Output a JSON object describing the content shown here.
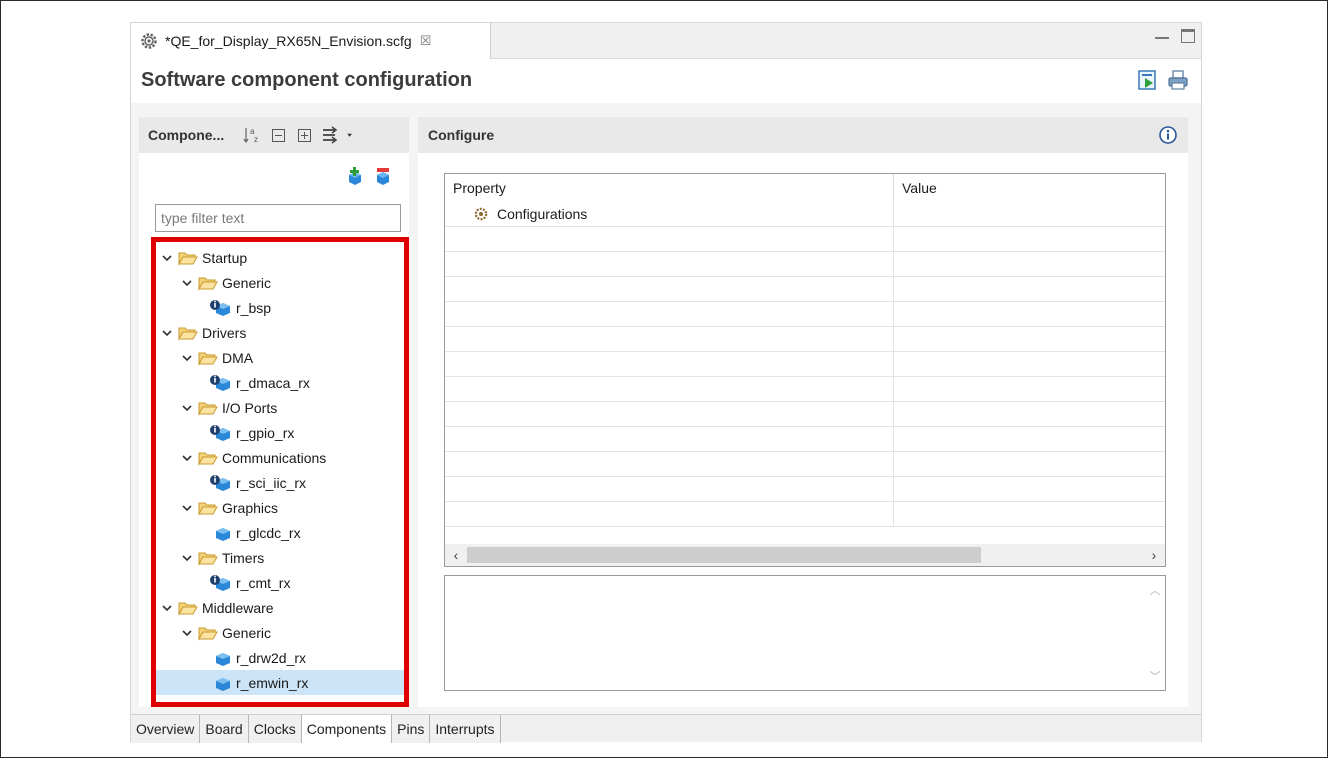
{
  "editor": {
    "tab_title": "*QE_for_Display_RX65N_Envision.scfg",
    "close_glyph": "☒"
  },
  "header": {
    "title": "Software component configuration",
    "icons": [
      "generate-code-icon",
      "print-icon"
    ]
  },
  "left_panel": {
    "title": "Compone...",
    "toolbar_icons": [
      "sort-az-icon",
      "collapse-all-icon",
      "expand-all-icon",
      "link-filter-icon",
      "dropdown-arrow-icon"
    ],
    "filter_placeholder": "type filter text",
    "tree": [
      {
        "label": "Startup",
        "level": 0,
        "type": "folder"
      },
      {
        "label": "Generic",
        "level": 1,
        "type": "folder"
      },
      {
        "label": "r_bsp",
        "level": 2,
        "type": "component-info"
      },
      {
        "label": "Drivers",
        "level": 0,
        "type": "folder"
      },
      {
        "label": "DMA",
        "level": 1,
        "type": "folder"
      },
      {
        "label": "r_dmaca_rx",
        "level": 2,
        "type": "component-info"
      },
      {
        "label": "I/O Ports",
        "level": 1,
        "type": "folder"
      },
      {
        "label": "r_gpio_rx",
        "level": 2,
        "type": "component-info"
      },
      {
        "label": "Communications",
        "level": 1,
        "type": "folder"
      },
      {
        "label": "r_sci_iic_rx",
        "level": 2,
        "type": "component-info"
      },
      {
        "label": "Graphics",
        "level": 1,
        "type": "folder"
      },
      {
        "label": "r_glcdc_rx",
        "level": 2,
        "type": "component"
      },
      {
        "label": "Timers",
        "level": 1,
        "type": "folder"
      },
      {
        "label": "r_cmt_rx",
        "level": 2,
        "type": "component-info"
      },
      {
        "label": "Middleware",
        "level": 0,
        "type": "folder"
      },
      {
        "label": "Generic",
        "level": 1,
        "type": "folder"
      },
      {
        "label": "r_drw2d_rx",
        "level": 2,
        "type": "component"
      },
      {
        "label": "r_emwin_rx",
        "level": 2,
        "type": "component",
        "selected": true
      }
    ]
  },
  "right_panel": {
    "title": "Configure",
    "table": {
      "headers": [
        "Property",
        "Value"
      ],
      "rows": [
        {
          "property": "Configurations",
          "value": ""
        }
      ]
    }
  },
  "bottom_tabs": [
    {
      "label": "Overview",
      "active": false
    },
    {
      "label": "Board",
      "active": false
    },
    {
      "label": "Clocks",
      "active": false
    },
    {
      "label": "Components",
      "active": true
    },
    {
      "label": "Pins",
      "active": false
    },
    {
      "label": "Interrupts",
      "active": false
    }
  ],
  "colors": {
    "highlight_border": "#e00000",
    "selection": "#cce4f7",
    "folder": "#e8b84a",
    "component": "#2b87d8"
  }
}
